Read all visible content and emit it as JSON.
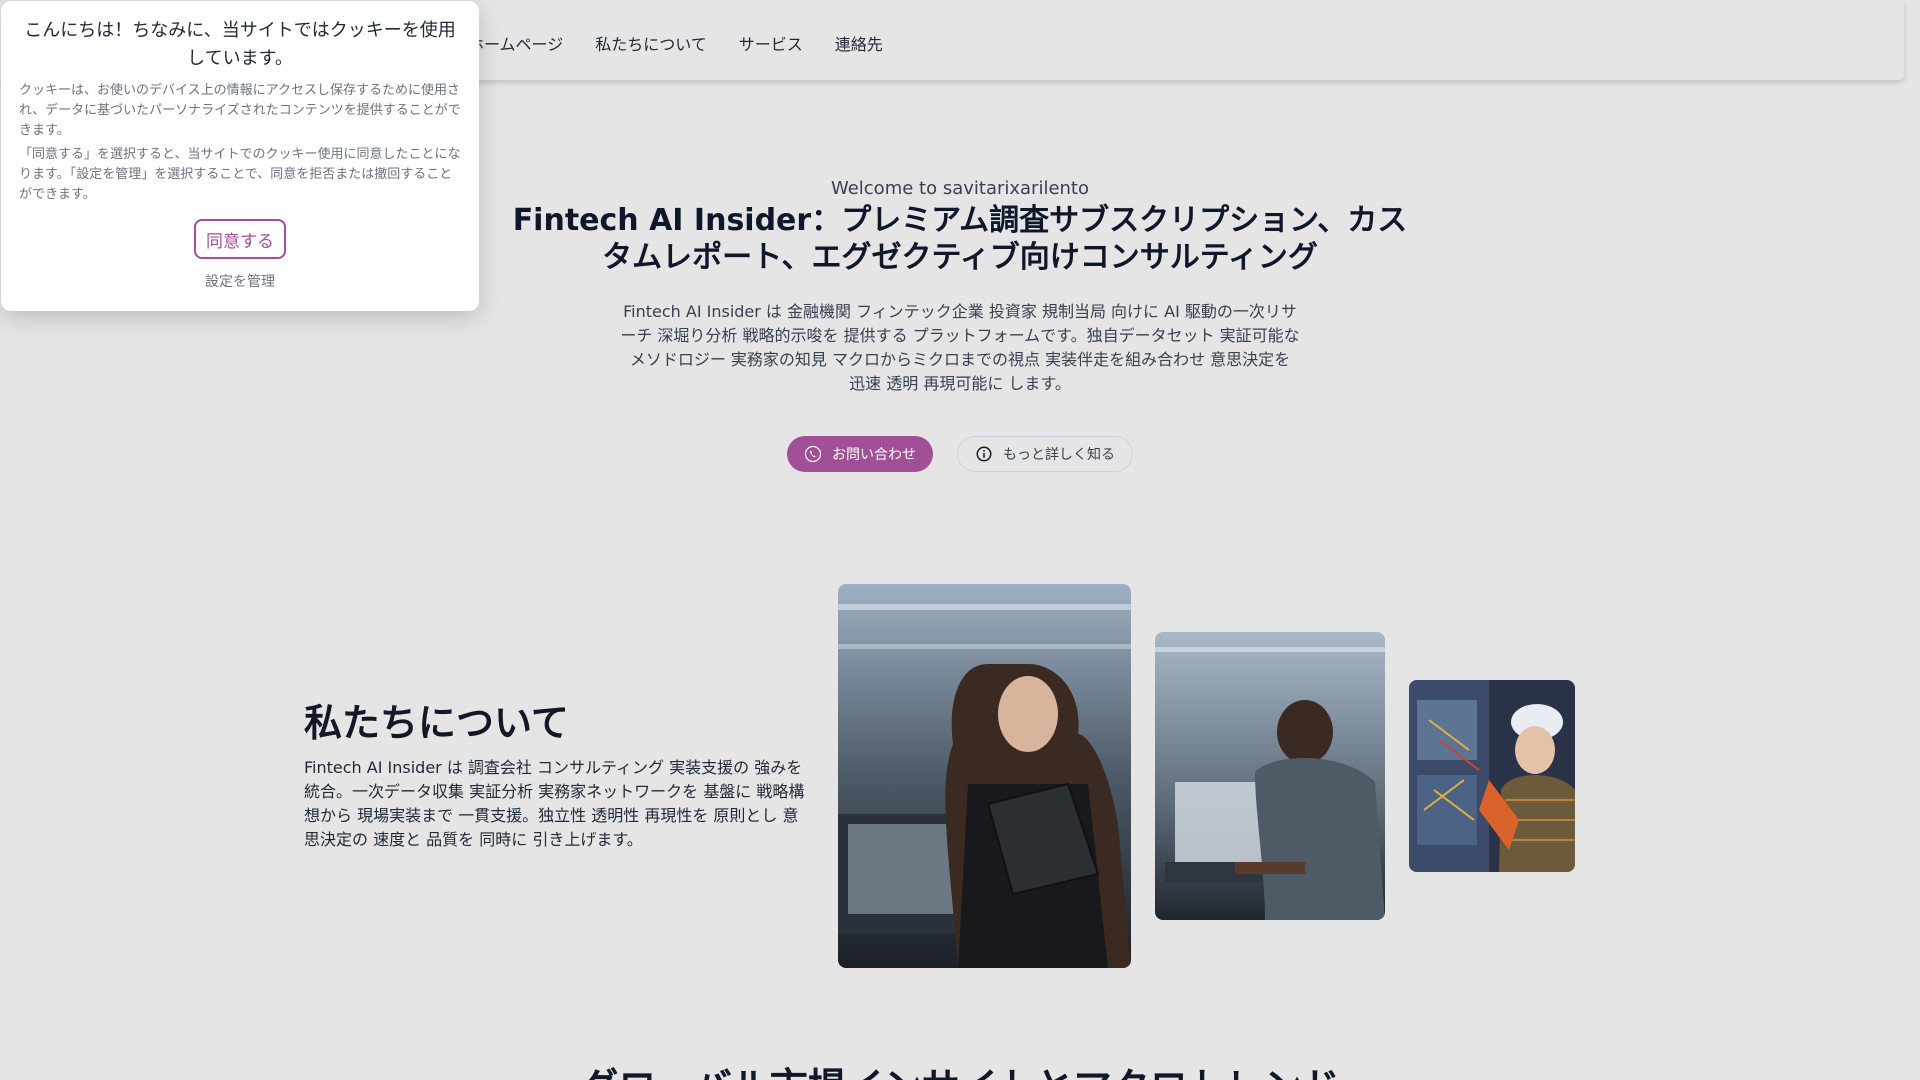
{
  "nav": {
    "items": [
      {
        "label": "ホームページ"
      },
      {
        "label": "私たちについて"
      },
      {
        "label": "サービス"
      },
      {
        "label": "連絡先"
      }
    ]
  },
  "hero": {
    "welcome": "Welcome to savitarixarilento",
    "title": "Fintech AI Insider：プレミアム調査サブスクリプション、カスタムレポート、エグゼクティブ向けコンサルティング",
    "description": "Fintech AI Insider は 金融機関 フィンテック企業 投資家 規制当局 向けに AI 駆動の一次リサーチ 深堀り分析 戦略的示唆を 提供する プラットフォームです。独自データセット 実証可能なメソドロジー 実務家の知見 マクロからミクロまでの視点 実装伴走を組み合わせ 意思決定を 迅速 透明 再現可能に します。",
    "primary_button": "お問い合わせ",
    "secondary_button": "もっと詳しく知る"
  },
  "about": {
    "title": "私たちについて",
    "text": "Fintech AI Insider は 調査会社 コンサルティング 実装支援の 強みを統合。一次データ収集 実証分析 実務家ネットワークを 基盤に 戦略構想から 現場実装まで 一貫支援。独立性 透明性 再現性を 原則とし 意思決定の 速度と 品質を 同時に 引き上げます。"
  },
  "next_section": {
    "title": "グローバル市場インサイトとマクロトレンド"
  },
  "cookie": {
    "title": "こんにちは！ちなみに、当サイトではクッキーを使用しています。",
    "body_1": "クッキーは、お使いのデバイス上の情報にアクセスし保存するために使用され、データに基づいたパーソナライズされたコンテンツを提供することができます。",
    "body_2": "「同意する」を選択すると、当サイトでのクッキー使用に同意したことになります。「設定を管理」を選択することで、同意を拒否または撤回することができます。",
    "accept": "同意する",
    "manage": "設定を管理"
  },
  "colors": {
    "accent": "#a14f96",
    "background": "#e5e5e5"
  },
  "icons": {
    "primary_button": "phone-icon",
    "secondary_button": "info-icon"
  }
}
